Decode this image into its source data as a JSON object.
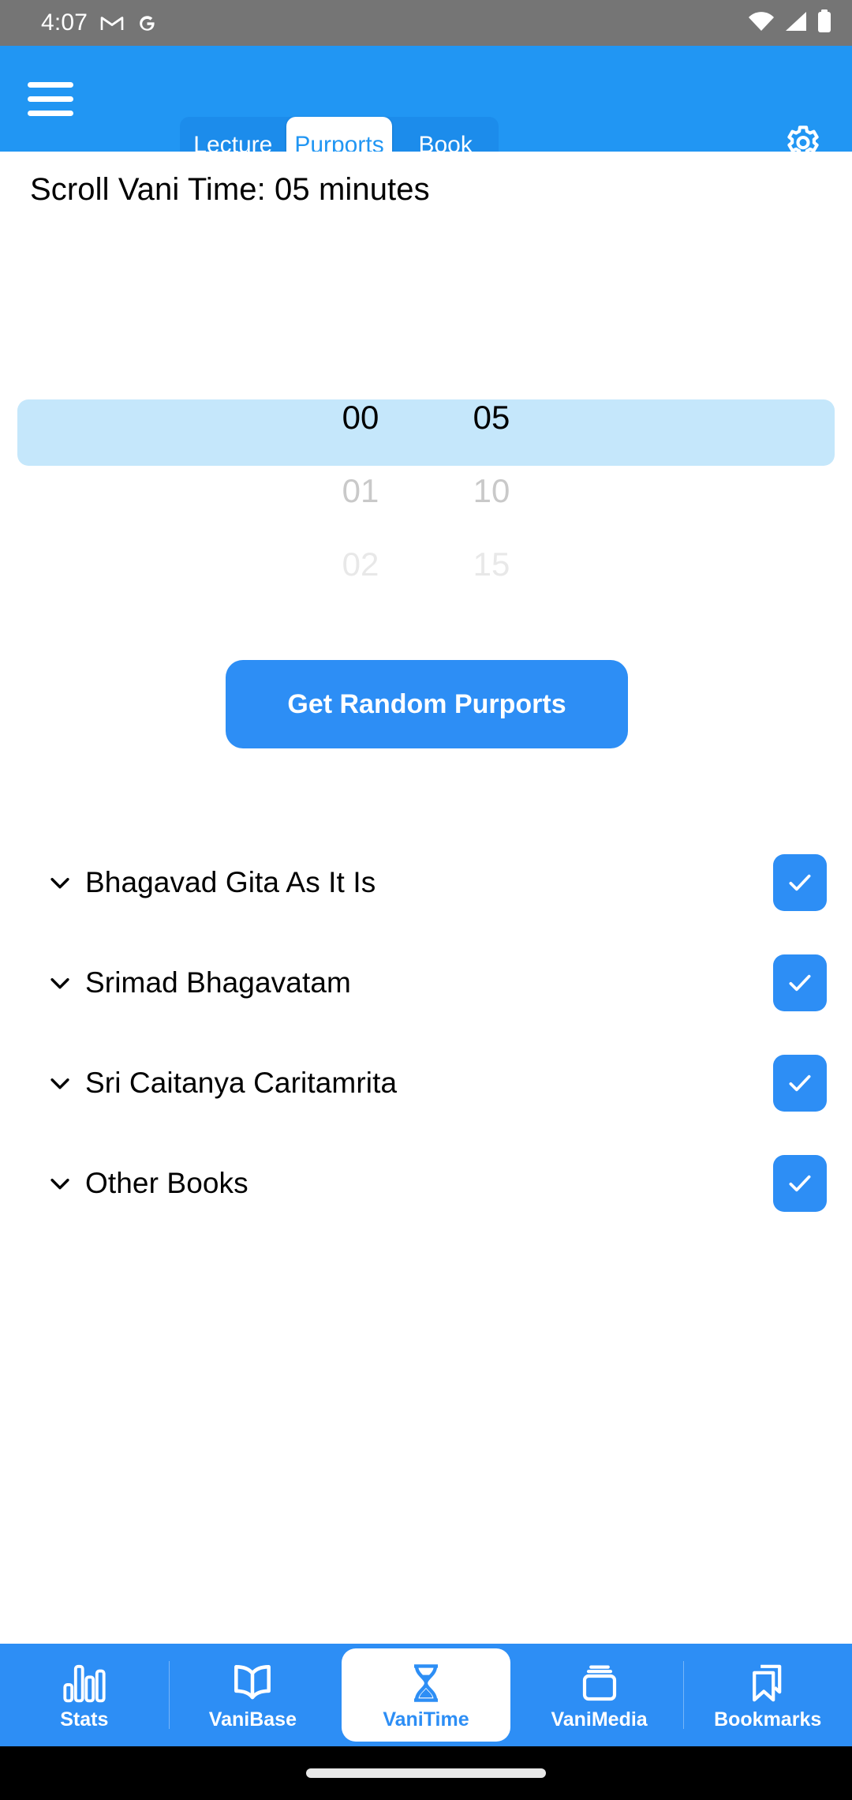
{
  "status_bar": {
    "time": "4:07",
    "icons": [
      "gmail-icon",
      "google-icon",
      "wifi-icon",
      "cellular-signal-icon",
      "battery-icon"
    ],
    "background_color": "#757575"
  },
  "app_bar": {
    "menu_icon": "hamburger-menu-icon",
    "settings_icon": "gear-icon",
    "background_color": "#2196f3",
    "tabs": [
      {
        "label": "Lecture",
        "active": false
      },
      {
        "label": "Purports",
        "active": true
      },
      {
        "label": "Book",
        "active": false
      }
    ]
  },
  "main": {
    "title": "Scroll Vani Time: 05 minutes",
    "picker": {
      "hours": {
        "selected": "00",
        "next": "01",
        "next2": "02"
      },
      "minutes": {
        "selected": "05",
        "next": "10",
        "next2": "15"
      },
      "highlight_color": "#c5e7fb"
    },
    "cta_button": {
      "label": "Get Random Purports",
      "color": "#2d8ef5"
    },
    "books": [
      {
        "label": "Bhagavad Gita As It Is",
        "checked": true
      },
      {
        "label": "Srimad Bhagavatam",
        "checked": true
      },
      {
        "label": "Sri Caitanya Caritamrita",
        "checked": true
      },
      {
        "label": "Other Books",
        "checked": true
      }
    ],
    "chevron_icon": "chevron-down-icon",
    "checkbox_color": "#2d8ef5"
  },
  "bottom_nav": {
    "background_color": "#2d8ef5",
    "items": [
      {
        "label": "Stats",
        "icon": "bar-chart-icon",
        "active": false
      },
      {
        "label": "VaniBase",
        "icon": "open-book-icon",
        "active": false
      },
      {
        "label": "VaniTime",
        "icon": "hourglass-icon",
        "active": true
      },
      {
        "label": "VaniMedia",
        "icon": "stacked-layers-icon",
        "active": false
      },
      {
        "label": "Bookmarks",
        "icon": "bookmarks-icon",
        "active": false
      }
    ]
  }
}
